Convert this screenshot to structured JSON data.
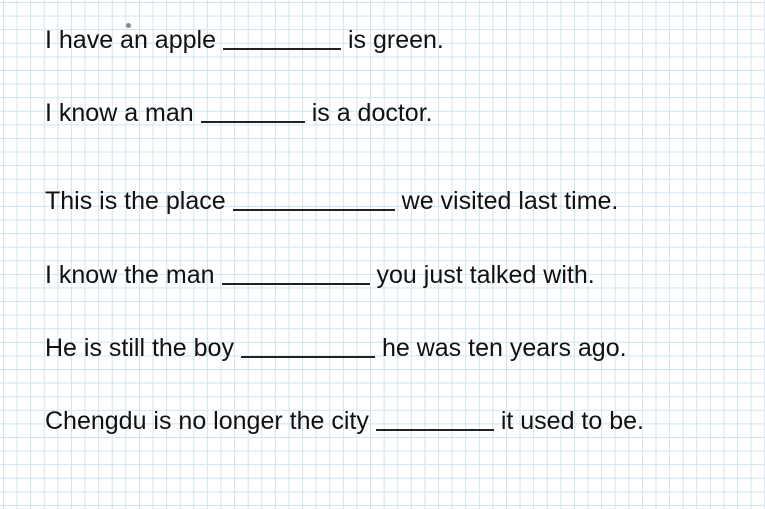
{
  "worksheet": {
    "sentences": [
      {
        "before": "I have an apple",
        "after": "is green."
      },
      {
        "before": "I know a man",
        "after": "is a doctor."
      },
      {
        "before": "This is the place",
        "after": "we visited last time."
      },
      {
        "before": "I know the man",
        "after": "you just talked with."
      },
      {
        "before": "He is still the boy",
        "after": "he was ten years ago."
      },
      {
        "before": "Chengdu is no longer the city",
        "after": "it used to be."
      }
    ]
  },
  "colors": {
    "grid_line": "#cfe3ee",
    "text": "#111111",
    "background": "#ffffff"
  }
}
